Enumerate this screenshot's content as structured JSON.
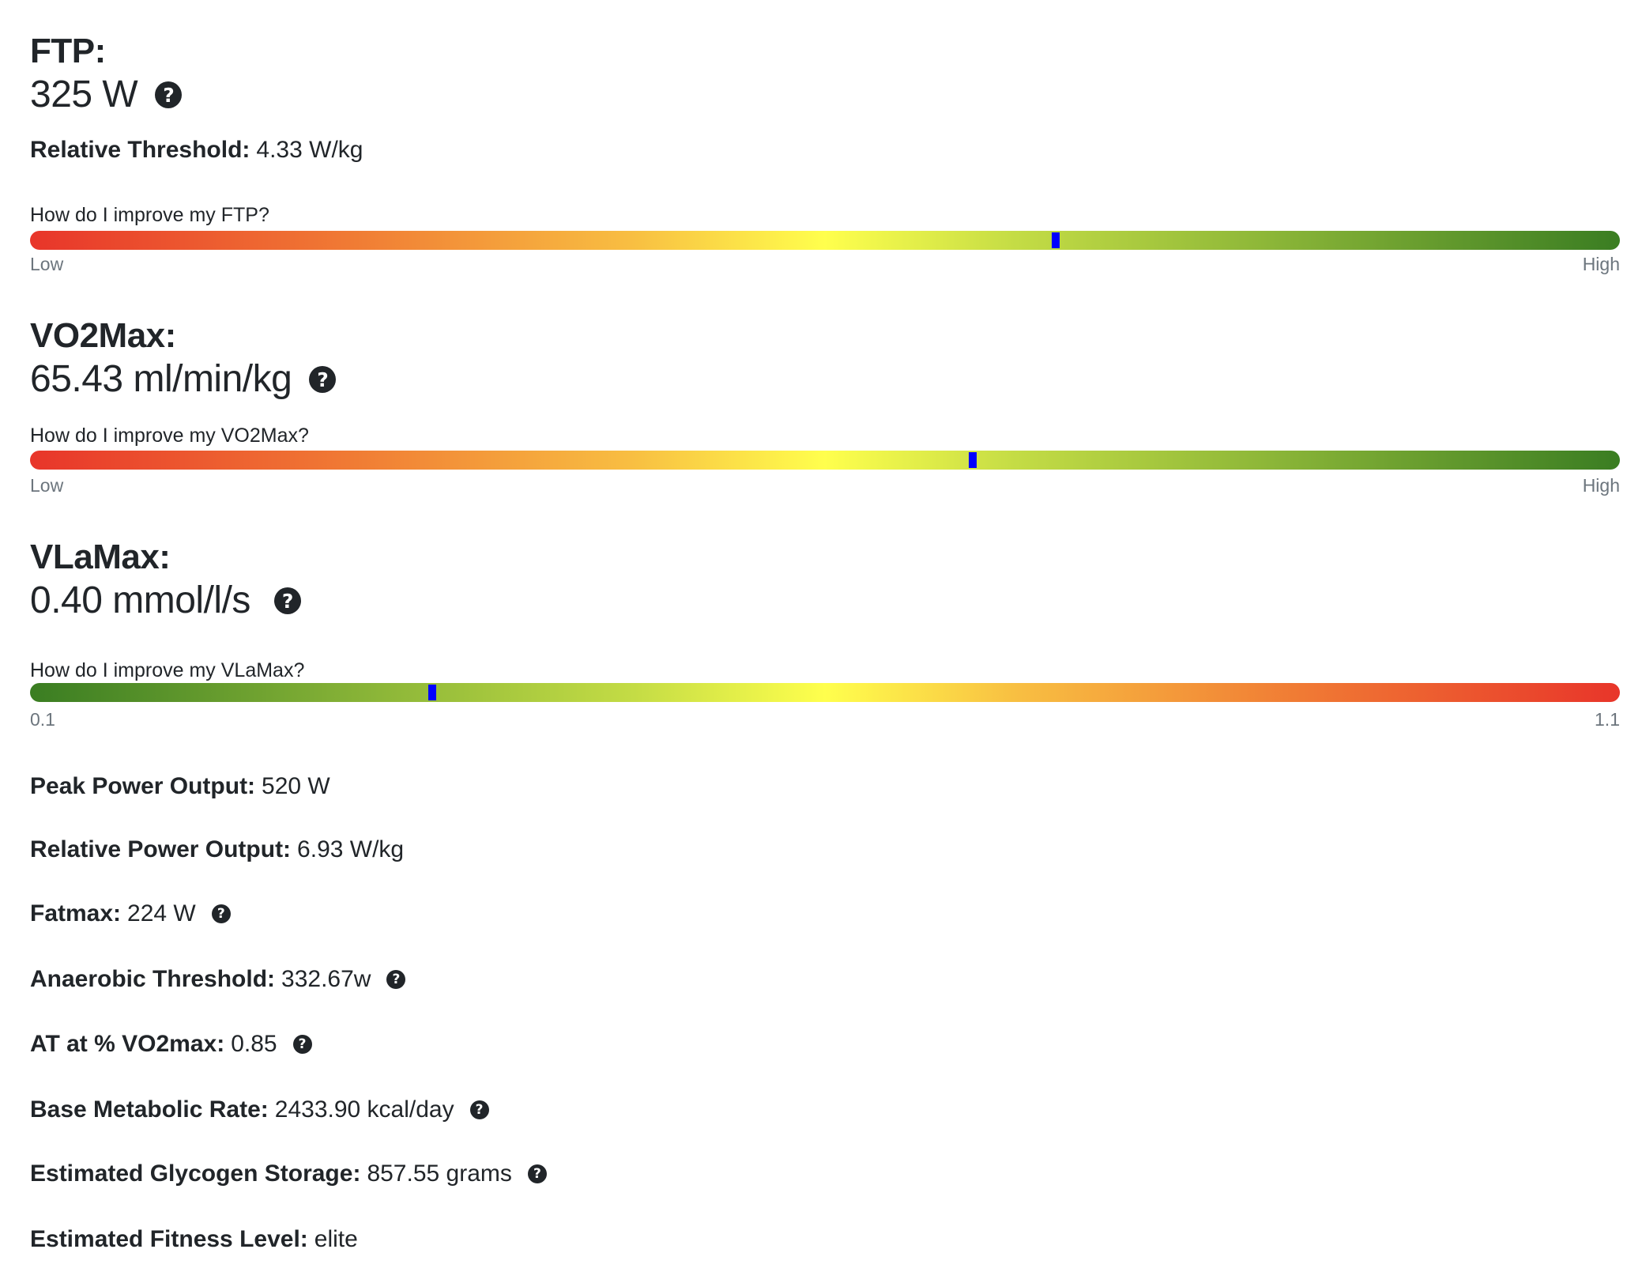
{
  "ftp": {
    "title": "FTP:",
    "value": "325 W",
    "help_icon": "question-circle-icon",
    "relative_label": "Relative Threshold:",
    "relative_value": "4.33 W/kg",
    "improve_link": "How do I improve my FTP?",
    "scale": {
      "min_label": "Low",
      "max_label": "High",
      "direction": "low-red-to-high-green",
      "marker_fraction": 0.645
    }
  },
  "vo2max": {
    "title": "VO2Max:",
    "value": "65.43 ml/min/kg",
    "help_icon": "question-circle-icon",
    "improve_link": "How do I improve my VO2Max?",
    "scale": {
      "min_label": "Low",
      "max_label": "High",
      "direction": "low-red-to-high-green",
      "marker_fraction": 0.593
    }
  },
  "vlamax": {
    "title": "VLaMax:",
    "value": "0.40 mmol/l/s",
    "help_icon": "question-circle-icon",
    "improve_link": "How do I improve my VLaMax?",
    "scale": {
      "min_label": "0.1",
      "max_label": "1.1",
      "direction": "low-green-to-high-red",
      "marker_fraction": 0.253
    }
  },
  "stats": [
    {
      "label": "Peak Power Output:",
      "value": "520 W",
      "has_help": false
    },
    {
      "label": "Relative Power Output:",
      "value": "6.93 W/kg",
      "has_help": false
    },
    {
      "label": "Fatmax:",
      "value": "224 W",
      "has_help": true
    },
    {
      "label": "Anaerobic Threshold:",
      "value": "332.67w",
      "has_help": true
    },
    {
      "label": "AT at % VO2max:",
      "value": "0.85",
      "has_help": true
    },
    {
      "label": "Base Metabolic Rate:",
      "value": "2433.90 kcal/day",
      "has_help": true
    },
    {
      "label": "Estimated Glycogen Storage:",
      "value": "857.55 grams",
      "has_help": true
    },
    {
      "label": "Estimated Fitness Level:",
      "value": "elite",
      "has_help": false
    }
  ],
  "colors": {
    "text": "#212529",
    "muted": "#6c757d",
    "marker": "#0000ff",
    "gradient_low": "#e8352a",
    "gradient_mid": "#ffff4d",
    "gradient_high": "#3a7d22"
  },
  "help_glyph": "?"
}
